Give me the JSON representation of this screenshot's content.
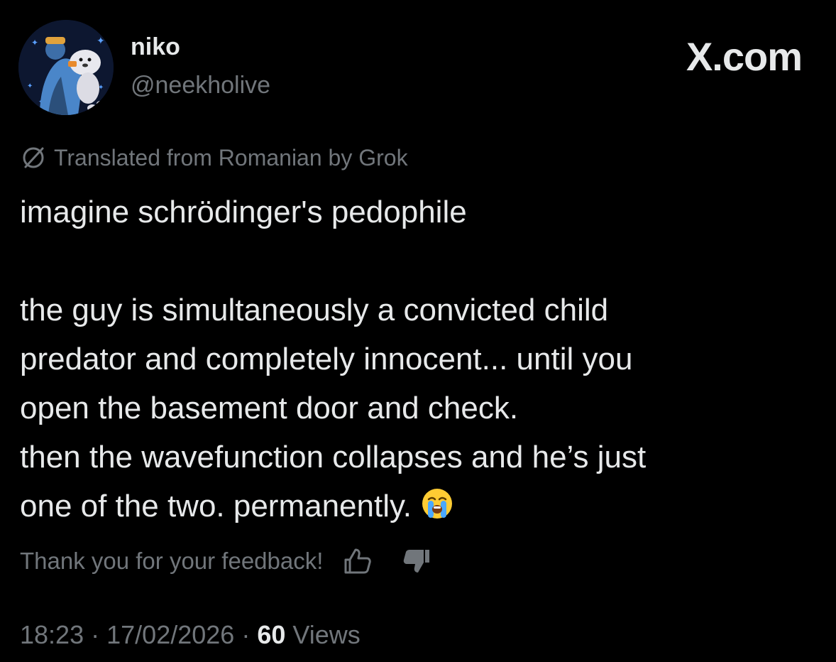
{
  "author": {
    "display_name": "niko",
    "handle": "@neekholive"
  },
  "brand": "X.com",
  "translation_note": "Translated from Romanian by Grok",
  "post": {
    "lines": [
      "imagine schrödinger's pedophile",
      "",
      "the guy is simultaneously a convicted child",
      "predator and completely innocent... until you",
      "open the basement door and check.",
      "then the wavefunction collapses and he’s just",
      "one of the two. permanently."
    ],
    "trailing_emoji": "loudly-crying-face-emoji"
  },
  "feedback": {
    "text": "Thank you for your feedback!",
    "icons": [
      "thumbs-up-icon",
      "thumbs-down-icon"
    ]
  },
  "meta": {
    "time": "18:23",
    "date": "17/02/2026",
    "separator": "·",
    "views_count": "60",
    "views_label": "Views"
  },
  "colors": {
    "background": "#000000",
    "primary_text": "#e7e9ea",
    "secondary_text": "#71767b",
    "avatar_bg": "#0d1730"
  }
}
